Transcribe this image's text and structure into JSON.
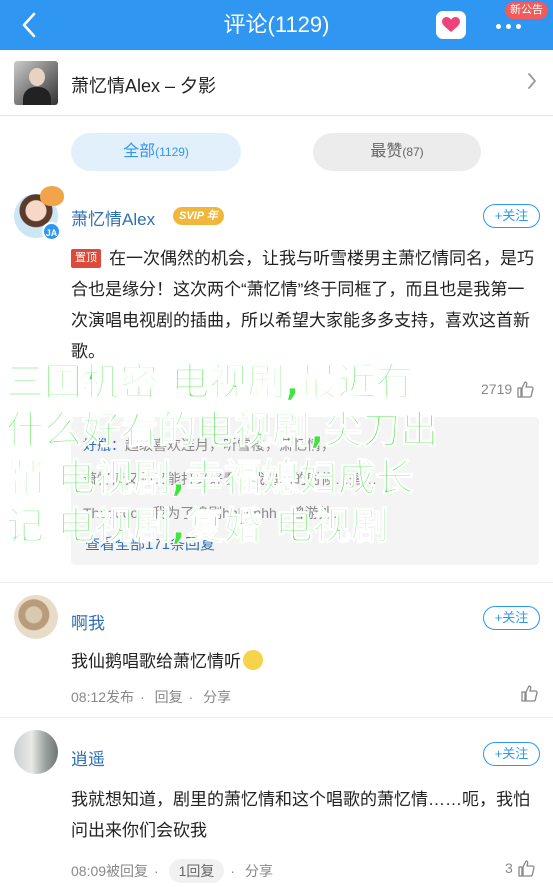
{
  "header": {
    "title": "评论(1129)",
    "notice_badge": "新公告",
    "accent": "#2f97f2"
  },
  "song": {
    "title": "萧忆情Alex – 夕影"
  },
  "tabs": [
    {
      "label": "全部",
      "count": "(1129)",
      "active": true
    },
    {
      "label": "最赞",
      "count": "(87)",
      "active": false
    }
  ],
  "comments": [
    {
      "user": "萧忆情Alex",
      "vip": "SVIP 年",
      "verified_mark": "JA",
      "follow": "+关注",
      "pin_tag": "置顶",
      "text": "在一次偶然的机会，让我与听雪楼男主萧忆情同名，是巧合也是缘分！这次两个“萧忆情”终于同框了，而且也是我第一次演唱电视剧的插曲，所以希望大家能多多支持，喜欢这首新歌。",
      "likes": "2719",
      "replies": [
        {
          "name": "好瓶：",
          "text": "超级喜欢连月，听雪楼，萧忆情，"
        },
        {
          "name": "",
          "text": "萧忆情又帅又能打又好看，我追剧的时候…落…"
        },
        {
          "name": "",
          "text": "Thooooo：我为了追剧hhhhhhh，曾游处…"
        }
      ],
      "view_all": "查看全部171条回复"
    },
    {
      "user": "啊我",
      "follow": "+关注",
      "text": "我仙鹅唱歌给萧忆情听",
      "time": "08:12发布",
      "reply": "回复",
      "share": "分享"
    },
    {
      "user": "逍遥",
      "follow": "+关注",
      "text": "我就想知道，剧里的萧忆情和这个唱歌的萧忆情……呃，我怕问出来你们会砍我",
      "time": "08:09被回复",
      "reply": "1回复",
      "share": "分享",
      "likes": "3"
    }
  ],
  "overlay": {
    "lines": [
      "三国机密 电视剧,最近有",
      "什么好看的电视剧,尖刀出",
      "鞘 电视剧,幸福媳妇成长",
      "记 电视剧,复婚 电视剧"
    ],
    "color": "#3fe53c"
  }
}
